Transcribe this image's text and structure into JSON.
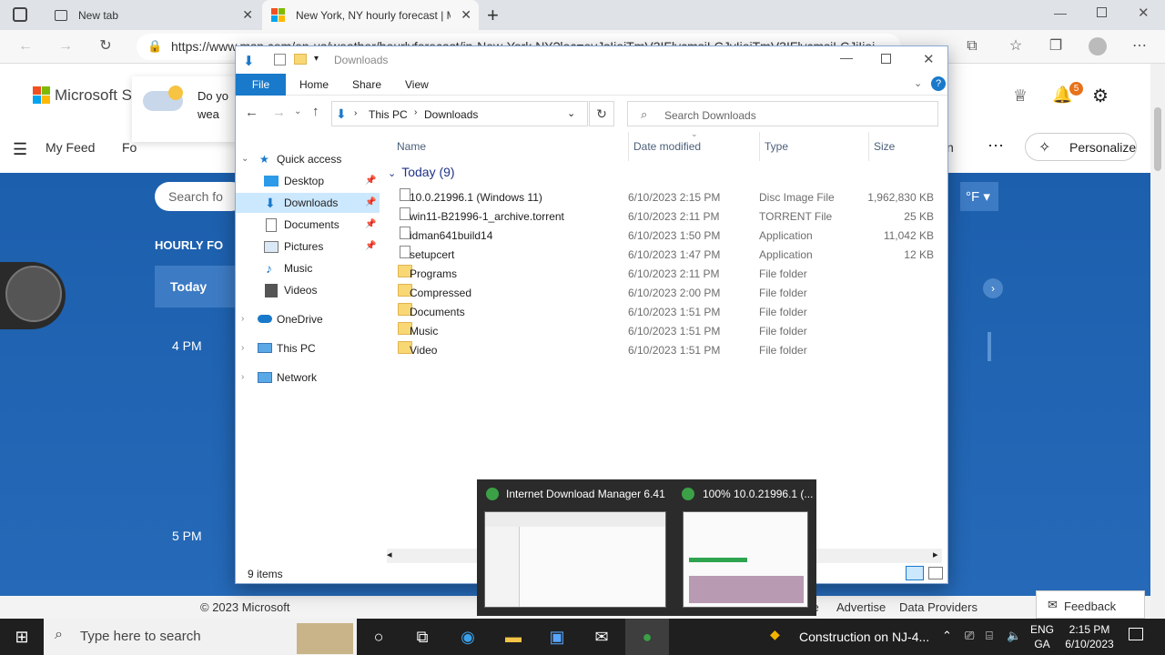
{
  "browser": {
    "tabs": [
      {
        "label": "New tab"
      },
      {
        "label": "New York, NY hourly forecast | M"
      }
    ],
    "url": "https://www.msn.com/en-us/weather/hourlyforecast/in-New-York,NY?loc=eyJsIjoiTmV3IFlvcmsiLCJyIjoiTmV3IFlvcmsiLCJjIjoi"
  },
  "msn": {
    "brand": "Microsoft St",
    "promo": "Do yo",
    "promo2": "wea",
    "nav_my_feed": "My Feed",
    "nav_fo": "Fo",
    "nav_n": "n",
    "personalize": "Personalize",
    "notif_count": "5",
    "search_placeholder": "Search fo",
    "unit": "°F",
    "hourly_title": "HOURLY FO",
    "today": "Today",
    "time1": "4 PM",
    "time2": "5 PM",
    "footer_copyright": "© 2023 Microsoft",
    "footer_se": "se",
    "footer_advertise": "Advertise",
    "footer_data": "Data Providers",
    "feedback": "Feedback"
  },
  "explorer": {
    "title": "Downloads",
    "ribbon": [
      "File",
      "Home",
      "Share",
      "View"
    ],
    "breadcrumb": [
      "This PC",
      "Downloads"
    ],
    "search_placeholder": "Search Downloads",
    "sidebar": [
      {
        "label": "Quick access",
        "icon": "star-icon"
      },
      {
        "label": "Desktop",
        "icon": "desktop-icon"
      },
      {
        "label": "Downloads",
        "icon": "download-icon"
      },
      {
        "label": "Documents",
        "icon": "document-icon"
      },
      {
        "label": "Pictures",
        "icon": "picture-icon"
      },
      {
        "label": "Music",
        "icon": "music-icon"
      },
      {
        "label": "Videos",
        "icon": "video-icon"
      },
      {
        "label": "OneDrive",
        "icon": "cloud-icon"
      },
      {
        "label": "This PC",
        "icon": "computer-icon"
      },
      {
        "label": "Network",
        "icon": "network-icon"
      }
    ],
    "columns": [
      "Name",
      "Date modified",
      "Type",
      "Size"
    ],
    "group": "Today (9)",
    "files": [
      {
        "name": "10.0.21996.1 (Windows 11)",
        "date": "6/10/2023 2:15 PM",
        "type": "Disc Image File",
        "size": "1,962,830 KB"
      },
      {
        "name": "win11-B21996-1_archive.torrent",
        "date": "6/10/2023 2:11 PM",
        "type": "TORRENT File",
        "size": "25 KB"
      },
      {
        "name": "idman641build14",
        "date": "6/10/2023 1:50 PM",
        "type": "Application",
        "size": "11,042 KB"
      },
      {
        "name": "setupcert",
        "date": "6/10/2023 1:47 PM",
        "type": "Application",
        "size": "12 KB"
      },
      {
        "name": "Programs",
        "date": "6/10/2023 2:11 PM",
        "type": "File folder",
        "size": ""
      },
      {
        "name": "Compressed",
        "date": "6/10/2023 2:00 PM",
        "type": "File folder",
        "size": ""
      },
      {
        "name": "Documents",
        "date": "6/10/2023 1:51 PM",
        "type": "File folder",
        "size": ""
      },
      {
        "name": "Music",
        "date": "6/10/2023 1:51 PM",
        "type": "File folder",
        "size": ""
      },
      {
        "name": "Video",
        "date": "6/10/2023 1:51 PM",
        "type": "File folder",
        "size": ""
      }
    ],
    "status": "9 items"
  },
  "preview": {
    "item1": "Internet Download Manager 6.41",
    "item2": "100% 10.0.21996.1 (..."
  },
  "taskbar": {
    "search_placeholder": "Type here to search",
    "news": "Construction on NJ-4...",
    "lang1": "ENG",
    "lang2": "GA",
    "time": "2:15 PM",
    "date": "6/10/2023"
  }
}
